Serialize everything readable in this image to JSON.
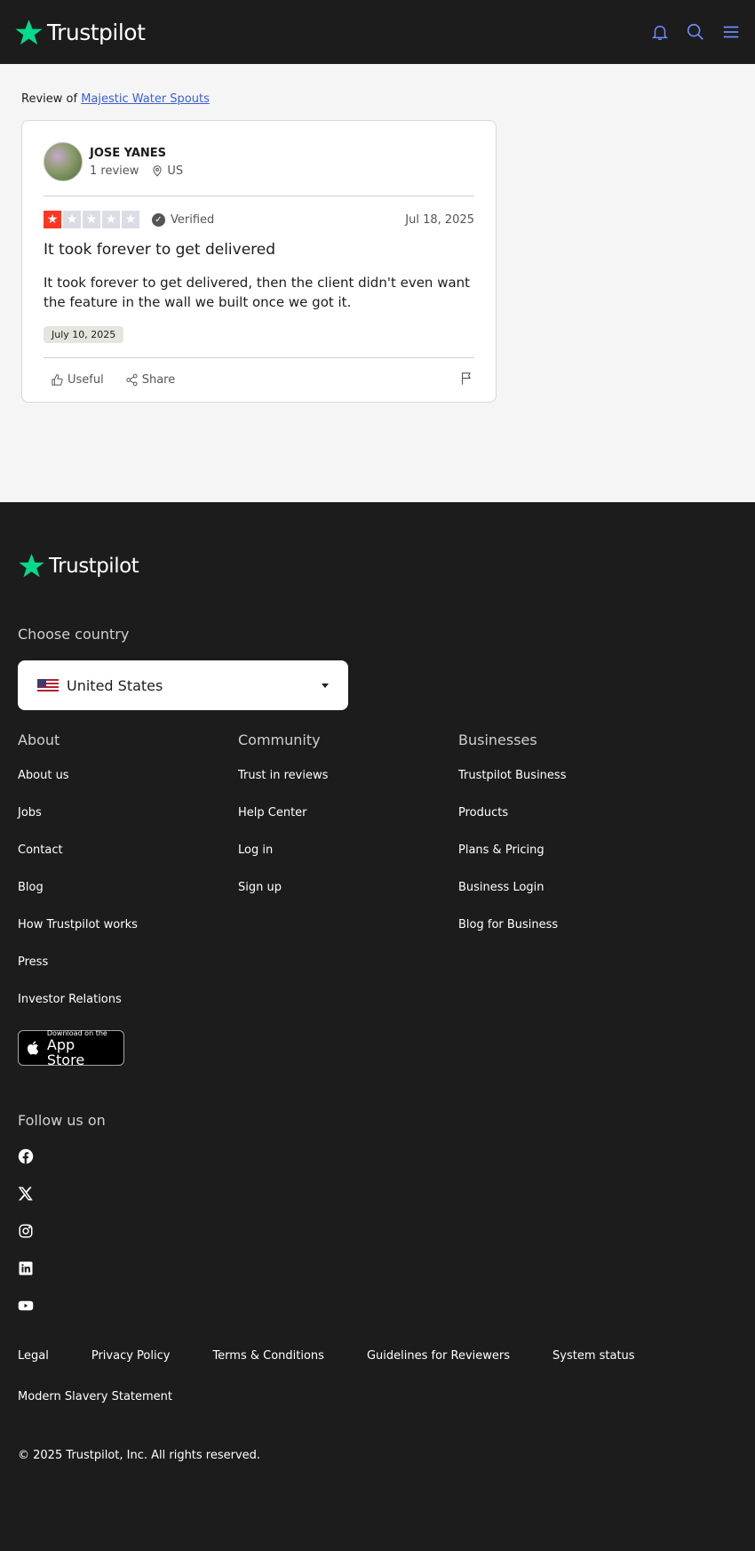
{
  "header": {
    "brand": "Trustpilot"
  },
  "review_of": {
    "prefix": "Review of",
    "company": "Majestic Water Spouts"
  },
  "review": {
    "reviewer_name": "JOSE YANES",
    "review_count": "1 review",
    "country": "US",
    "rating": 1,
    "verified_label": "Verified",
    "date": "Jul 18, 2025",
    "title": "It took forever to get delivered",
    "body": "It took forever to get delivered, then the client didn't even want the feature in the wall we built once we got it.",
    "experience_date": "July 10, 2025",
    "useful_label": "Useful",
    "share_label": "Share",
    "colors": {
      "star_on": "#ff3722",
      "star_off": "#dcdce6"
    }
  },
  "footer": {
    "brand": "Trustpilot",
    "choose_country_label": "Choose country",
    "selected_country": "United States",
    "columns": {
      "about": {
        "heading": "About",
        "links": [
          "About us",
          "Jobs",
          "Contact",
          "Blog",
          "How Trustpilot works",
          "Press",
          "Investor Relations"
        ]
      },
      "community": {
        "heading": "Community",
        "links": [
          "Trust in reviews",
          "Help Center",
          "Log in",
          "Sign up"
        ]
      },
      "businesses": {
        "heading": "Businesses",
        "links": [
          "Trustpilot Business",
          "Products",
          "Plans & Pricing",
          "Business Login",
          "Blog for Business"
        ]
      }
    },
    "app_store": {
      "small": "Download on the",
      "big": "App Store"
    },
    "follow_label": "Follow us on",
    "socials": [
      "facebook-icon",
      "x-icon",
      "instagram-icon",
      "linkedin-icon",
      "youtube-icon"
    ],
    "legal_links": [
      "Legal",
      "Privacy Policy",
      "Terms & Conditions",
      "Guidelines for Reviewers",
      "System status"
    ],
    "legal_link_2": "Modern Slavery Statement",
    "copyright": "© 2025 Trustpilot, Inc. All rights reserved."
  },
  "brand_color": "#04da8d"
}
